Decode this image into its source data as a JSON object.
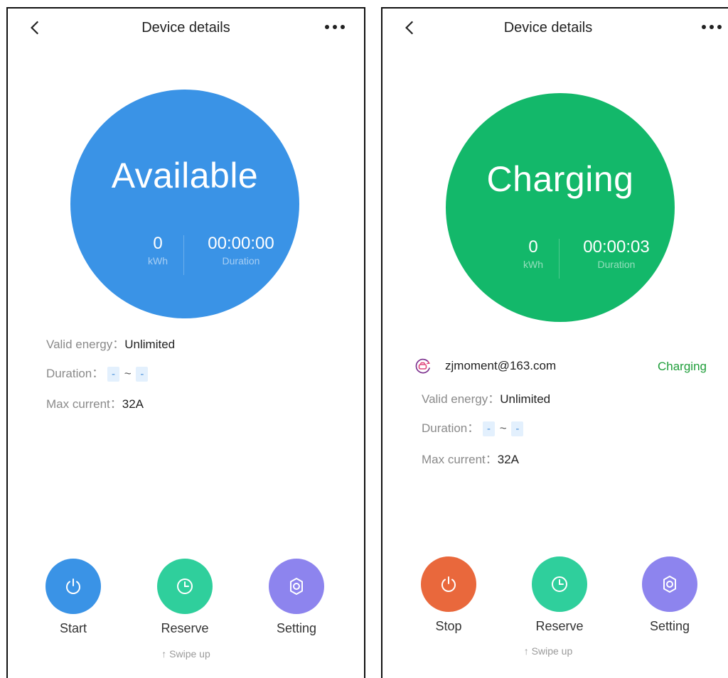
{
  "colors": {
    "available": "#3a93e6",
    "charging": "#13b86a",
    "start": "#3a93e6",
    "stop": "#e9683c",
    "reserve": "#2fcf9c",
    "setting": "#8d84ee",
    "charging_text": "#1f9e3a"
  },
  "left": {
    "header": {
      "back_icon": "chevron-left-icon",
      "title": "Device details",
      "more_icon": "more-horizontal-icon"
    },
    "status": "Available",
    "energy": {
      "value": "0",
      "unit": "kWh"
    },
    "duration": {
      "value": "00:00:00",
      "label": "Duration"
    },
    "info": {
      "valid_energy_label": "Valid energy：",
      "valid_energy_value": "Unlimited",
      "duration_label": "Duration：",
      "duration_from": "-",
      "duration_sep": "~",
      "duration_to": "-",
      "max_current_label": "Max current：",
      "max_current_value": "32A"
    },
    "actions": [
      {
        "label": "Start",
        "icon": "power-icon"
      },
      {
        "label": "Reserve",
        "icon": "clock-icon"
      },
      {
        "label": "Setting",
        "icon": "gear-icon"
      }
    ],
    "swipe_hint": "↑ Swipe up"
  },
  "right": {
    "header": {
      "back_icon": "chevron-left-icon",
      "title": "Device details",
      "more_icon": "more-horizontal-icon"
    },
    "status": "Charging",
    "energy": {
      "value": "0",
      "unit": "kWh"
    },
    "duration": {
      "value": "00:00:03",
      "label": "Duration"
    },
    "user": {
      "icon": "car-charging-icon",
      "email": "zjmoment@163.com",
      "status": "Charging"
    },
    "info": {
      "valid_energy_label": "Valid energy：",
      "valid_energy_value": "Unlimited",
      "duration_label": "Duration：",
      "duration_from": "-",
      "duration_sep": "~",
      "duration_to": "-",
      "max_current_label": "Max current：",
      "max_current_value": "32A"
    },
    "actions": [
      {
        "label": "Stop",
        "icon": "power-icon"
      },
      {
        "label": "Reserve",
        "icon": "clock-icon"
      },
      {
        "label": "Setting",
        "icon": "gear-icon"
      }
    ],
    "swipe_hint": "↑ Swipe up"
  }
}
